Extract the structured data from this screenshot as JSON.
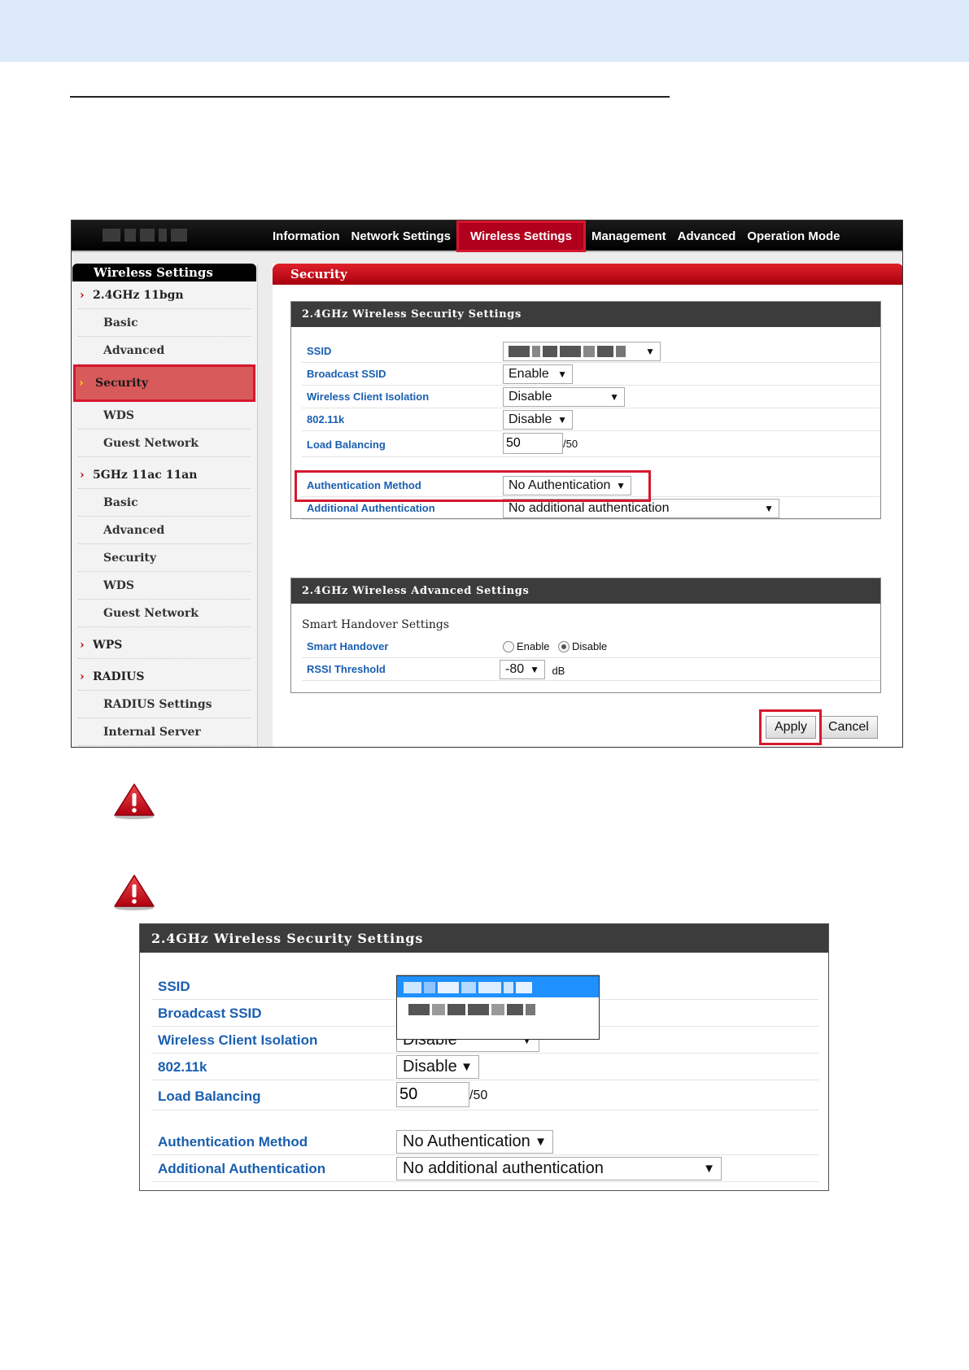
{
  "screenshot1": {
    "nav": [
      "Information",
      "Network Settings",
      "Wireless Settings",
      "Management",
      "Advanced",
      "Operation Mode"
    ],
    "nav_active": "Wireless Settings",
    "sidebar": {
      "heading": "Wireless Settings",
      "items": [
        {
          "kind": "group",
          "label": "2.4GHz 11bgn"
        },
        {
          "kind": "item",
          "label": "Basic"
        },
        {
          "kind": "item",
          "label": "Advanced"
        },
        {
          "kind": "active",
          "label": "Security"
        },
        {
          "kind": "item",
          "label": "WDS"
        },
        {
          "kind": "item",
          "label": "Guest Network"
        },
        {
          "kind": "group",
          "label": "5GHz 11ac 11an"
        },
        {
          "kind": "item",
          "label": "Basic"
        },
        {
          "kind": "item",
          "label": "Advanced"
        },
        {
          "kind": "item",
          "label": "Security"
        },
        {
          "kind": "item",
          "label": "WDS"
        },
        {
          "kind": "item",
          "label": "Guest Network"
        },
        {
          "kind": "group",
          "label": "WPS"
        },
        {
          "kind": "group",
          "label": "RADIUS"
        },
        {
          "kind": "item",
          "label": "RADIUS Settings"
        },
        {
          "kind": "item",
          "label": "Internal Server"
        }
      ]
    },
    "main_heading": "Security",
    "security_panel": {
      "title": "2.4GHz Wireless Security Settings",
      "ssid_label": "SSID",
      "broadcast_label": "Broadcast SSID",
      "broadcast_value": "Enable",
      "isolation_label": "Wireless Client Isolation",
      "isolation_value": "Disable",
      "k_label": "802.11k",
      "k_value": "Disable",
      "lb_label": "Load Balancing",
      "lb_value": "50",
      "lb_max": "/50",
      "auth_label": "Authentication Method",
      "auth_value": "No Authentication",
      "add_auth_label": "Additional Authentication",
      "add_auth_value": "No additional authentication"
    },
    "advanced_panel": {
      "title": "2.4GHz Wireless Advanced Settings",
      "subheading": "Smart Handover Settings",
      "handover_label": "Smart Handover",
      "enable_label": "Enable",
      "disable_label": "Disable",
      "handover_selected": "Disable",
      "rssi_label": "RSSI Threshold",
      "rssi_value": "-80",
      "rssi_unit": "dB"
    },
    "apply_label": "Apply",
    "cancel_label": "Cancel"
  },
  "screenshot2": {
    "title": "2.4GHz Wireless Security Settings",
    "ssid_label": "SSID",
    "broadcast_label": "Broadcast SSID",
    "isolation_label": "Wireless Client Isolation",
    "isolation_value": "Disable",
    "k_label": "802.11k",
    "k_value": "Disable",
    "lb_label": "Load Balancing",
    "lb_value": "50",
    "lb_max": "/50",
    "auth_label": "Authentication Method",
    "auth_value": "No Authentication",
    "add_auth_label": "Additional Authentication",
    "add_auth_value": "No additional authentication"
  },
  "colors": {
    "accent_red": "#d6182e",
    "label_blue": "#1a5fb0",
    "dropdown_highlight": "#1e90ff",
    "top_band": "#dce9f8"
  },
  "icons": [
    "warning-icon",
    "caret-down-icon",
    "chevron-right-icon"
  ]
}
